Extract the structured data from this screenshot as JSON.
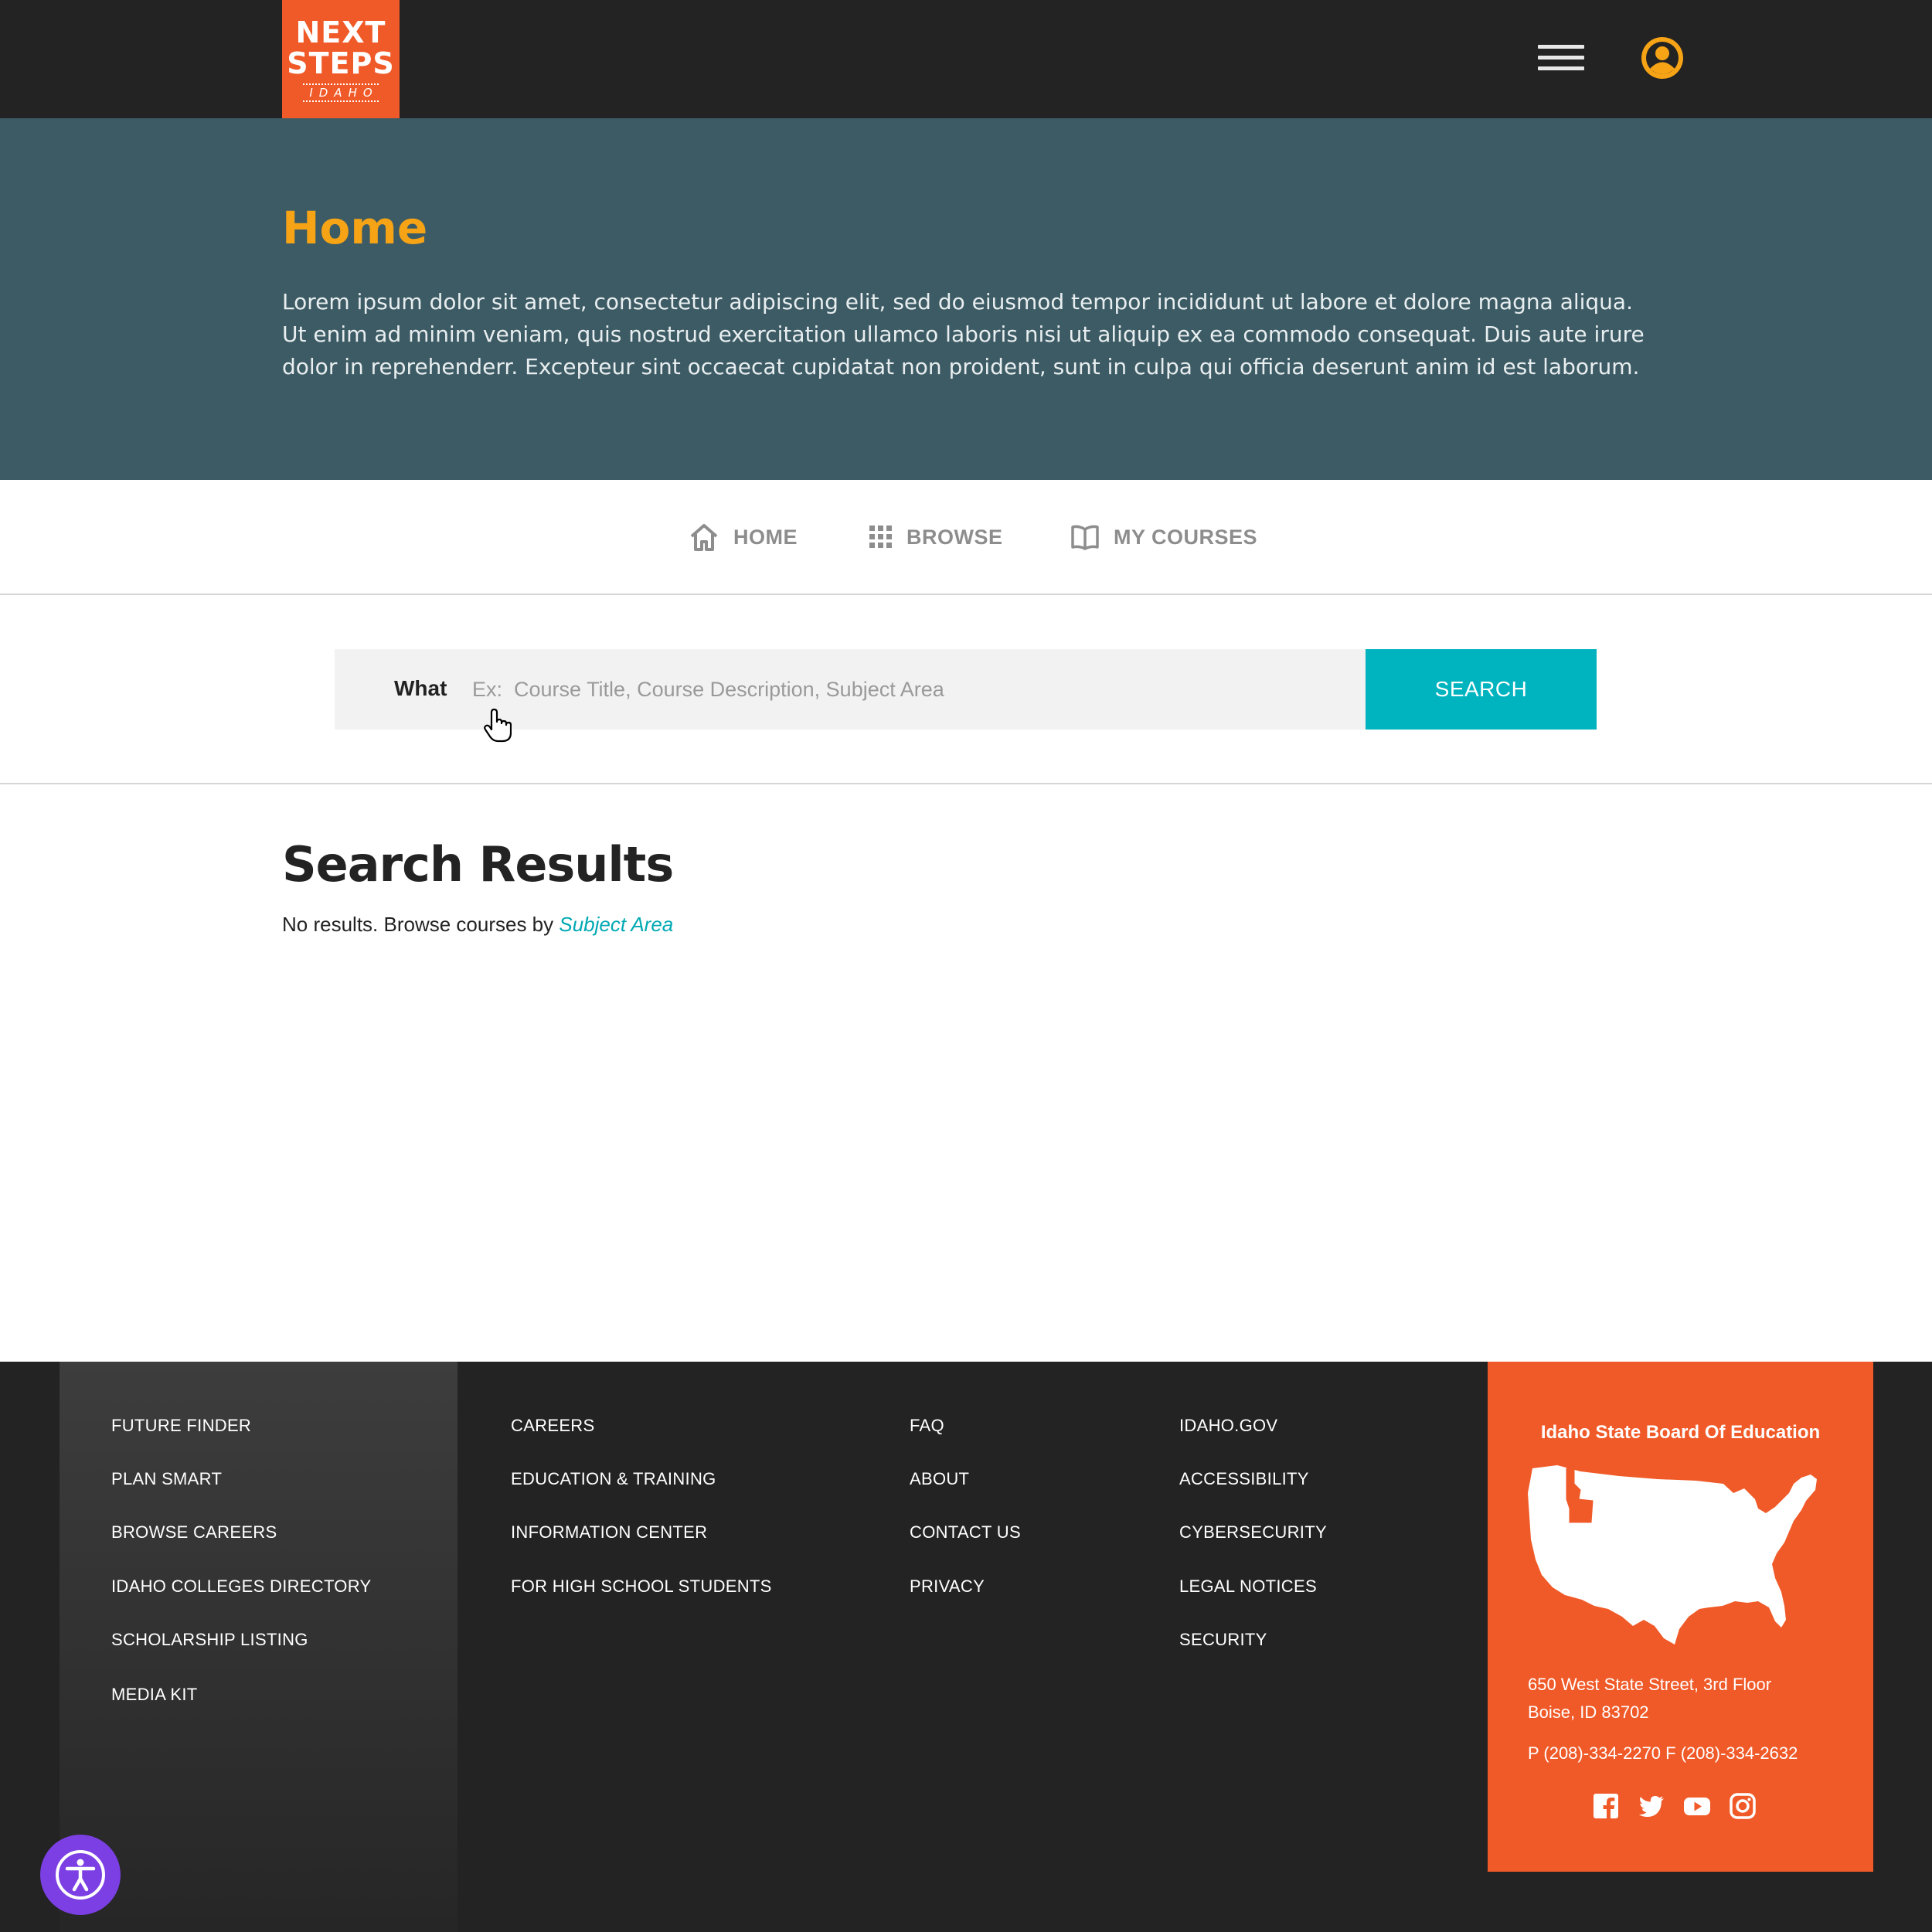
{
  "header": {
    "logo": {
      "line1": "NEXT",
      "line2": "STEPS",
      "line3": "IDAHO"
    },
    "menu_icon": "hamburger-menu-icon",
    "user_icon": "user-account-icon"
  },
  "hero": {
    "title": "Home",
    "body": "Lorem ipsum dolor sit amet, consectetur adipiscing elit, sed do eiusmod tempor incididunt ut labore et dolore magna aliqua. Ut enim ad minim veniam, quis nostrud exercitation ullamco laboris nisi ut aliquip ex ea commodo consequat. Duis aute irure dolor in reprehenderr. Excepteur sint occaecat cupidatat non proident, sunt in culpa qui officia deserunt anim id est laborum."
  },
  "nav": {
    "items": [
      {
        "label": "HOME",
        "icon": "home-icon"
      },
      {
        "label": "BROWSE",
        "icon": "grid-icon"
      },
      {
        "label": "MY COURSES",
        "icon": "open-book-icon"
      }
    ]
  },
  "search": {
    "label": "What",
    "value": "",
    "placeholder": "Ex:  Course Title, Course Description, Subject Area",
    "button_label": "SEARCH"
  },
  "results": {
    "title": "Search Results",
    "message": "No results.  Browse courses by ",
    "link_label": "Subject Area"
  },
  "footer": {
    "col1": [
      "FUTURE FINDER",
      "PLAN SMART",
      "BROWSE CAREERS",
      "IDAHO COLLEGES DIRECTORY",
      "SCHOLARSHIP LISTING",
      "MEDIA KIT"
    ],
    "col2": [
      "CAREERS",
      "EDUCATION & TRAINING",
      "INFORMATION CENTER",
      "FOR HIGH SCHOOL STUDENTS"
    ],
    "col3": [
      "FAQ",
      "ABOUT",
      "CONTACT US",
      "PRIVACY"
    ],
    "col4": [
      "IDAHO.GOV",
      "ACCESSIBILITY",
      "CYBERSECURITY",
      "LEGAL NOTICES",
      "SECURITY"
    ],
    "contact": {
      "title": "Idaho State Board Of Education",
      "address_line1": "650 West State Street, 3rd Floor",
      "address_line2": "Boise, ID 83702",
      "phone": "P (208)-334-2270  F (208)-334-2632",
      "socials": [
        "facebook-icon",
        "twitter-icon",
        "youtube-icon",
        "instagram-icon"
      ]
    }
  },
  "accessibility_icon": "accessibility-icon",
  "colors": {
    "header_bg": "#232323",
    "brand_orange": "#f05a28",
    "hero_bg": "#3d5b64",
    "hero_title": "#f6a316",
    "accent_teal": "#00b4bf",
    "a11y_purple": "#7b3fe4"
  }
}
